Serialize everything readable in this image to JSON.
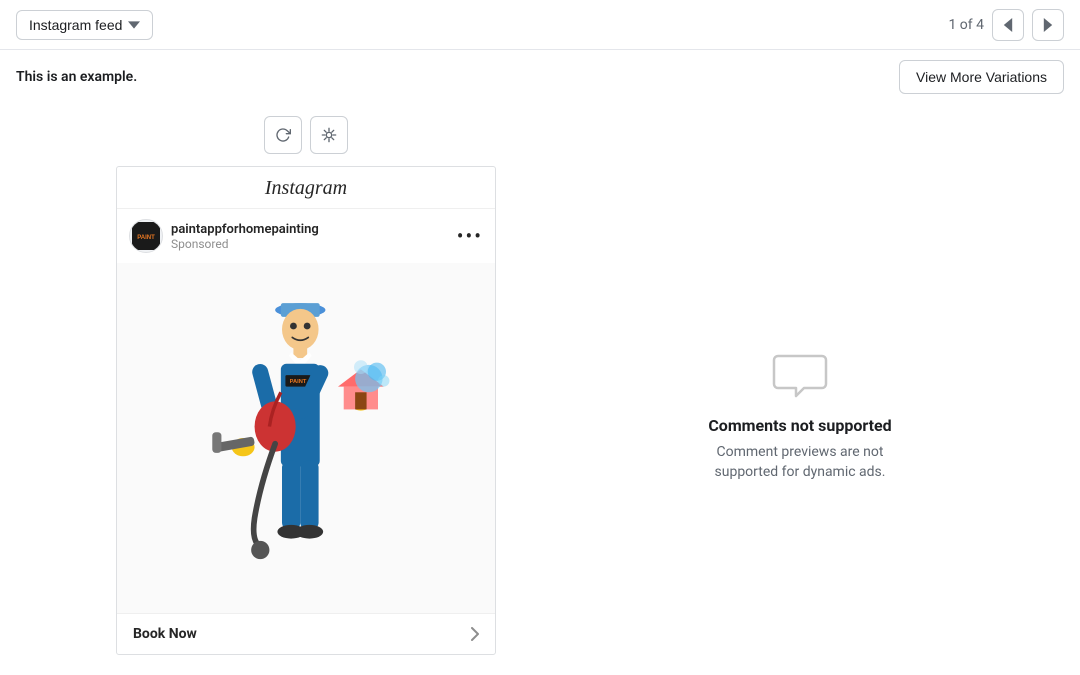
{
  "topBar": {
    "feedLabel": "Instagram feed",
    "pageIndicator": "1 of 4"
  },
  "secondaryBar": {
    "exampleText": "This is an example.",
    "viewMoreLabel": "View More Variations"
  },
  "instagramCard": {
    "headerText": "Instagram",
    "accountName": "paintappforhomepainting",
    "sponsoredLabel": "Sponsored",
    "bookNowLabel": "Book Now"
  },
  "commentsPanel": {
    "title": "Comments not supported",
    "description": "Comment previews are not supported for dynamic ads."
  },
  "icons": {
    "refresh": "↺",
    "bug": "🐞",
    "chevronLeft": "‹",
    "chevronRight": "›",
    "chevronRightSmall": "›",
    "moreOptions": "•••"
  }
}
